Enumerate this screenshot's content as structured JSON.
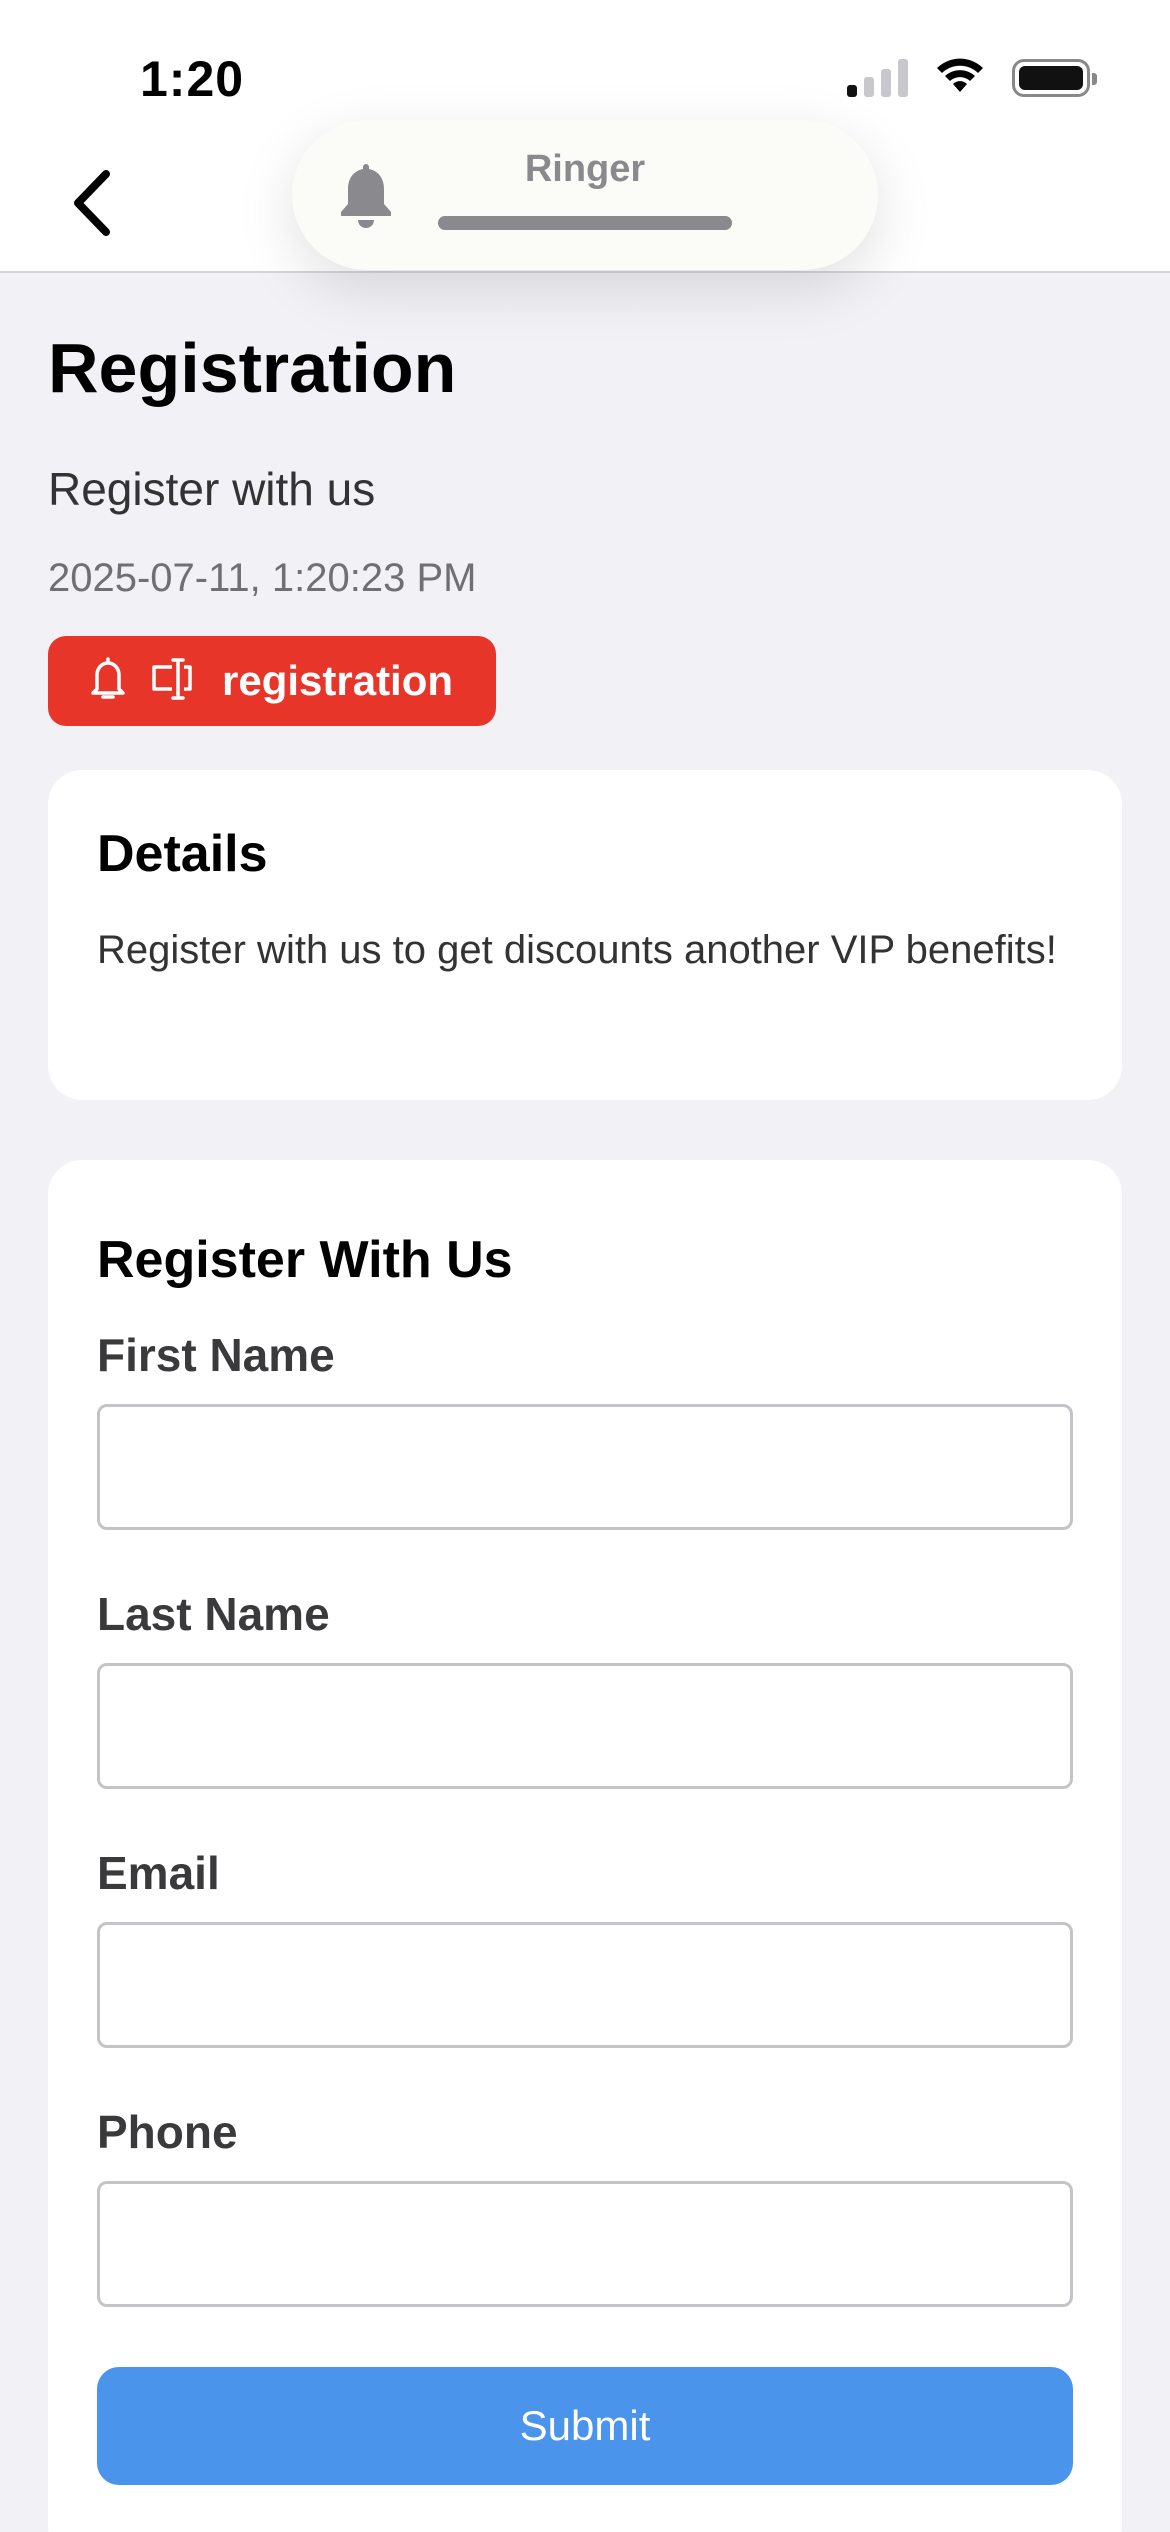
{
  "status_bar": {
    "time": "1:20",
    "signal_bars_active": 1,
    "signal_bars_total": 4
  },
  "nav": {
    "back_icon": "chevron-left-icon"
  },
  "ringer_overlay": {
    "icon": "bell-icon",
    "label": "Ringer"
  },
  "header": {
    "title": "Registration",
    "subtitle": "Register with us",
    "timestamp": "2025-07-11, 1:20:23 PM",
    "tag": {
      "icons": [
        "bell-outline-icon",
        "form-field-icon"
      ],
      "label": "registration",
      "color": "#e8352a"
    }
  },
  "details_card": {
    "title": "Details",
    "body": "Register with us to get discounts another VIP benefits!"
  },
  "form": {
    "title": "Register With Us",
    "fields": [
      {
        "label": "First Name",
        "value": ""
      },
      {
        "label": "Last Name",
        "value": ""
      },
      {
        "label": "Email",
        "value": ""
      },
      {
        "label": "Phone",
        "value": ""
      }
    ],
    "submit_label": "Submit",
    "submit_color": "#4a94ec"
  }
}
